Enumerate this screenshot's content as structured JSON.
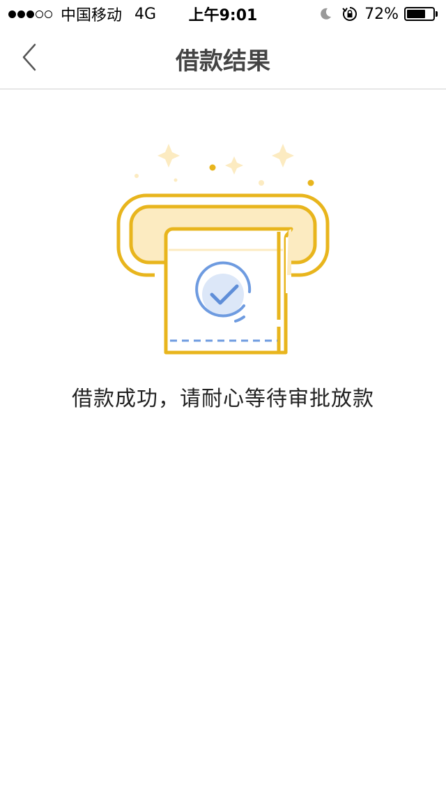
{
  "status_bar": {
    "carrier": "中国移动",
    "network": "4G",
    "time": "上午9:01",
    "battery_percent": "72%",
    "battery_level": 0.72,
    "signal_bars_filled": 3,
    "signal_bars_total": 5
  },
  "nav": {
    "title": "借款结果",
    "back_icon": "chevron-left-icon"
  },
  "main": {
    "illustration_icon": "receipt-printer-success-icon",
    "message": "借款成功，请耐心等待审批放款"
  },
  "colors": {
    "accent_gold": "#E8B51D",
    "light_gold": "#FCEBC1",
    "check_blue": "#6E9BE0",
    "check_fill": "#DCE7F8",
    "nav_text": "#444444"
  }
}
